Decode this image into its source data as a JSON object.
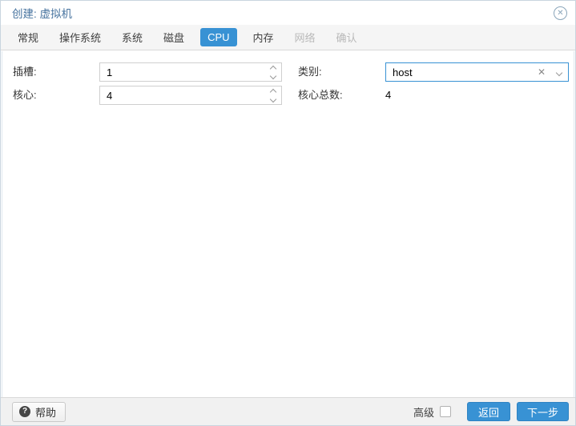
{
  "window": {
    "title": "创建: 虚拟机"
  },
  "icons": {
    "close": "✕",
    "help": "?",
    "clear": "✕"
  },
  "tabs": [
    {
      "label": "常规",
      "state": "normal"
    },
    {
      "label": "操作系统",
      "state": "normal"
    },
    {
      "label": "系统",
      "state": "normal"
    },
    {
      "label": "磁盘",
      "state": "normal"
    },
    {
      "label": "CPU",
      "state": "active"
    },
    {
      "label": "内存",
      "state": "normal"
    },
    {
      "label": "网络",
      "state": "disabled"
    },
    {
      "label": "确认",
      "state": "disabled"
    }
  ],
  "form": {
    "sockets": {
      "label": "插槽:",
      "value": "1"
    },
    "cores": {
      "label": "核心:",
      "value": "4"
    },
    "type": {
      "label": "类别:",
      "value": "host"
    },
    "total_cores": {
      "label": "核心总数:",
      "value": "4"
    }
  },
  "footer": {
    "help": "帮助",
    "advanced": "高级",
    "advanced_checked": false,
    "back": "返回",
    "next": "下一步"
  },
  "colors": {
    "accent": "#3892d4",
    "title_text": "#45729e",
    "tab_active_bg": "#3892d4",
    "combo_focus_border": "#3892d4"
  }
}
